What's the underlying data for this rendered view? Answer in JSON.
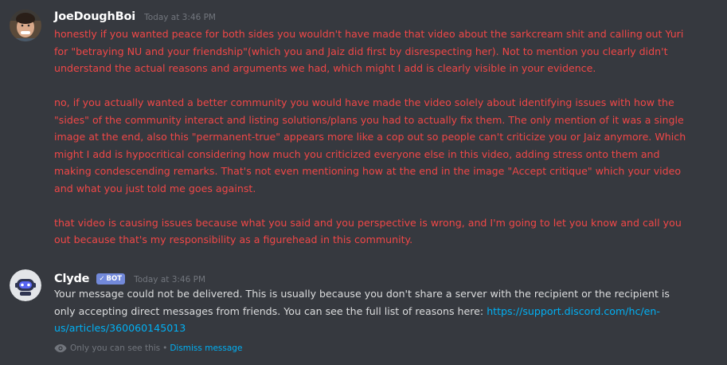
{
  "messages": [
    {
      "author": "JoeDoughBoi",
      "timestamp": "Today at 3:46 PM",
      "paragraphs": [
        [
          "honestly if you wanted peace for both sides you wouldn't have made that video about the sarkcream shit and calling out Yuri",
          "for \"betraying NU and your friendship\"(which you and Jaiz did first by disrespecting her). Not to mention you clearly didn't",
          "understand the actual reasons and arguments we had, which might I add is clearly visible in your evidence."
        ],
        [
          "no, if you actually wanted a better community you would have made the video solely about identifying issues with how the",
          "\"sides\" of the community interact and listing solutions/plans you had to actually fix them. The only mention of it was a single",
          "image at the end, also this \"permanent-true\" appears more like a cop out so people can't criticize you or Jaiz anymore. Which",
          "might I add is hypocritical considering how much you criticized everyone else in this video, adding stress onto them and",
          "making condescending remarks. That's not even mentioning how at the end in the image \"Accept critique\" which your video",
          "and what you just told me goes against."
        ],
        [
          "that video is causing issues because what you said and you perspective is wrong, and I'm going to let you know and call you",
          "out because that's my responsibility as a figurehead in this community."
        ]
      ]
    },
    {
      "author": "Clyde",
      "badge": "BOT",
      "timestamp": "Today at 3:46 PM",
      "lines": [
        "Your message could not be delivered. This is usually because you don't share a server with the recipient or the recipient is",
        "only accepting direct messages from friends. You can see the full list of reasons here: "
      ],
      "link_part1": "https://support.discord.com/hc/en-",
      "link_part2": "us/articles/360060145013",
      "ephemeral_note": "Only you can see this",
      "bullet": "•",
      "dismiss": "Dismiss message"
    }
  ],
  "colors": {
    "background": "#36393f",
    "error_text": "#f04747",
    "normal_text": "#dcddde",
    "link": "#00b0f4",
    "bot_badge": "#7289da",
    "muted": "#72767d"
  },
  "icons": {
    "verified_check": "check-icon",
    "ephemeral": "eye-icon"
  }
}
